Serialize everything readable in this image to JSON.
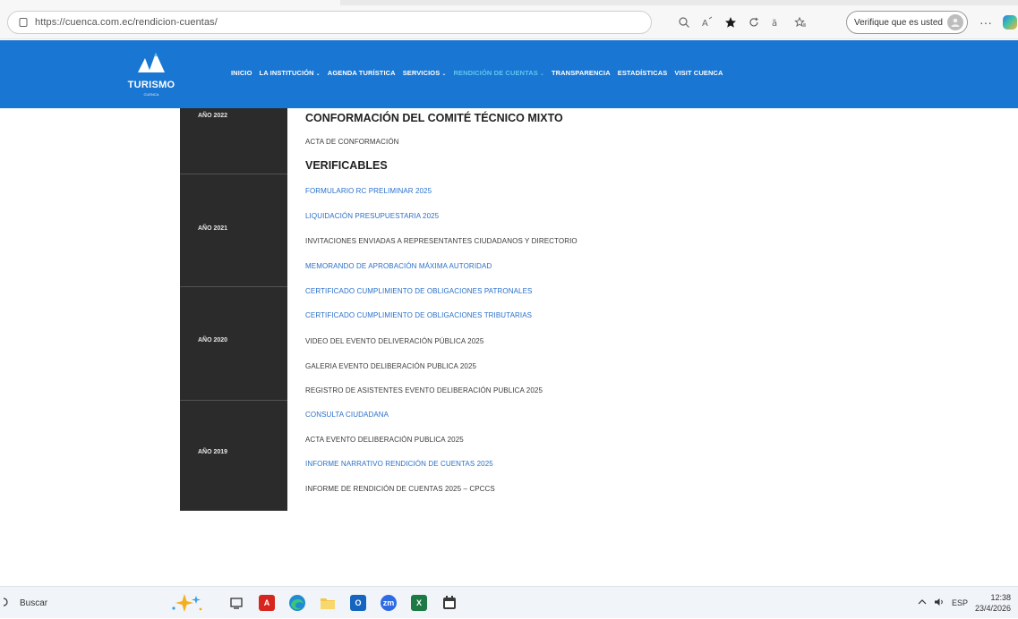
{
  "browser": {
    "url": "https://cuenca.com.ec/rendicion-cuentas/",
    "verify_label": "Verifique que es usted",
    "more_label": "···"
  },
  "site": {
    "logo_text": "TURISMO",
    "logo_sub": "CUENCA",
    "nav": [
      {
        "label": "INICIO",
        "dropdown": false
      },
      {
        "label": "LA INSTITUCIÓN",
        "dropdown": true
      },
      {
        "label": "AGENDA TURÍSTICA",
        "dropdown": false
      },
      {
        "label": "SERVICIOS",
        "dropdown": true
      },
      {
        "label": "RENDICIÓN DE CUENTAS",
        "dropdown": true
      },
      {
        "label": "TRANSPARENCIA",
        "dropdown": false
      },
      {
        "label": "ESTADÍSTICAS",
        "dropdown": false
      },
      {
        "label": "VISIT CUENCA",
        "dropdown": false
      }
    ],
    "nav_caret": "⌄",
    "colors": {
      "header": "#1976d2",
      "active_nav": "#5fc6ee",
      "link": "#2a70c9",
      "year_panel": "#2b2b2b"
    }
  },
  "years": [
    "AÑO 2022",
    "AÑO 2021",
    "AÑO 2020",
    "AÑO 2019"
  ],
  "sections": {
    "heading_main": "CONFORMACIÓN DEL COMITÉ TÉCNICO MIXTO",
    "acta": "ACTA DE CONFORMACIÓN",
    "heading_verificables": "VERIFICABLES",
    "documents": [
      {
        "label": "FORMULARIO RC PRELIMINAR 2025",
        "link": true
      },
      {
        "label": "LIQUIDACIÓN PRESUPUESTARIA 2025",
        "link": true
      },
      {
        "label": "INVITACIONES ENVIADAS A REPRESENTANTES CIUDADANOS Y DIRECTORIO",
        "link": false
      },
      {
        "label": "MEMORANDO DE APROBACIÓN MÁXIMA AUTORIDAD",
        "link": true
      },
      {
        "label": "CERTIFICADO CUMPLIMIENTO DE OBLIGACIONES PATRONALES",
        "link": true
      },
      {
        "label": "CERTIFICADO CUMPLIMIENTO DE OBLIGACIONES TRIBUTARIAS",
        "link": true
      },
      {
        "label": "VIDEO DEL EVENTO DELIVERACIÓN PÚBLICA 2025",
        "link": false
      },
      {
        "label": "GALERIA EVENTO DELIBERACIÓN PUBLICA 2025",
        "link": false
      },
      {
        "label": "REGISTRO DE ASISTENTES EVENTO DELIBERACIÓN PUBLICA 2025",
        "link": false
      },
      {
        "label": "CONSULTA CIUDADANA",
        "link": true
      },
      {
        "label": "ACTA EVENTO DELIBERACIÓN PUBLICA 2025",
        "link": false
      },
      {
        "label": "INFORME NARRATIVO RENDICIÓN DE CUENTAS 2025",
        "link": true
      },
      {
        "label": "INFORME DE RENDICIÓN DE CUENTAS 2025 – CPCCS",
        "link": false
      }
    ]
  },
  "taskbar": {
    "search_label": "Buscar",
    "tray_language": "ESP",
    "time": "12:38",
    "date": "23/4/2026"
  }
}
